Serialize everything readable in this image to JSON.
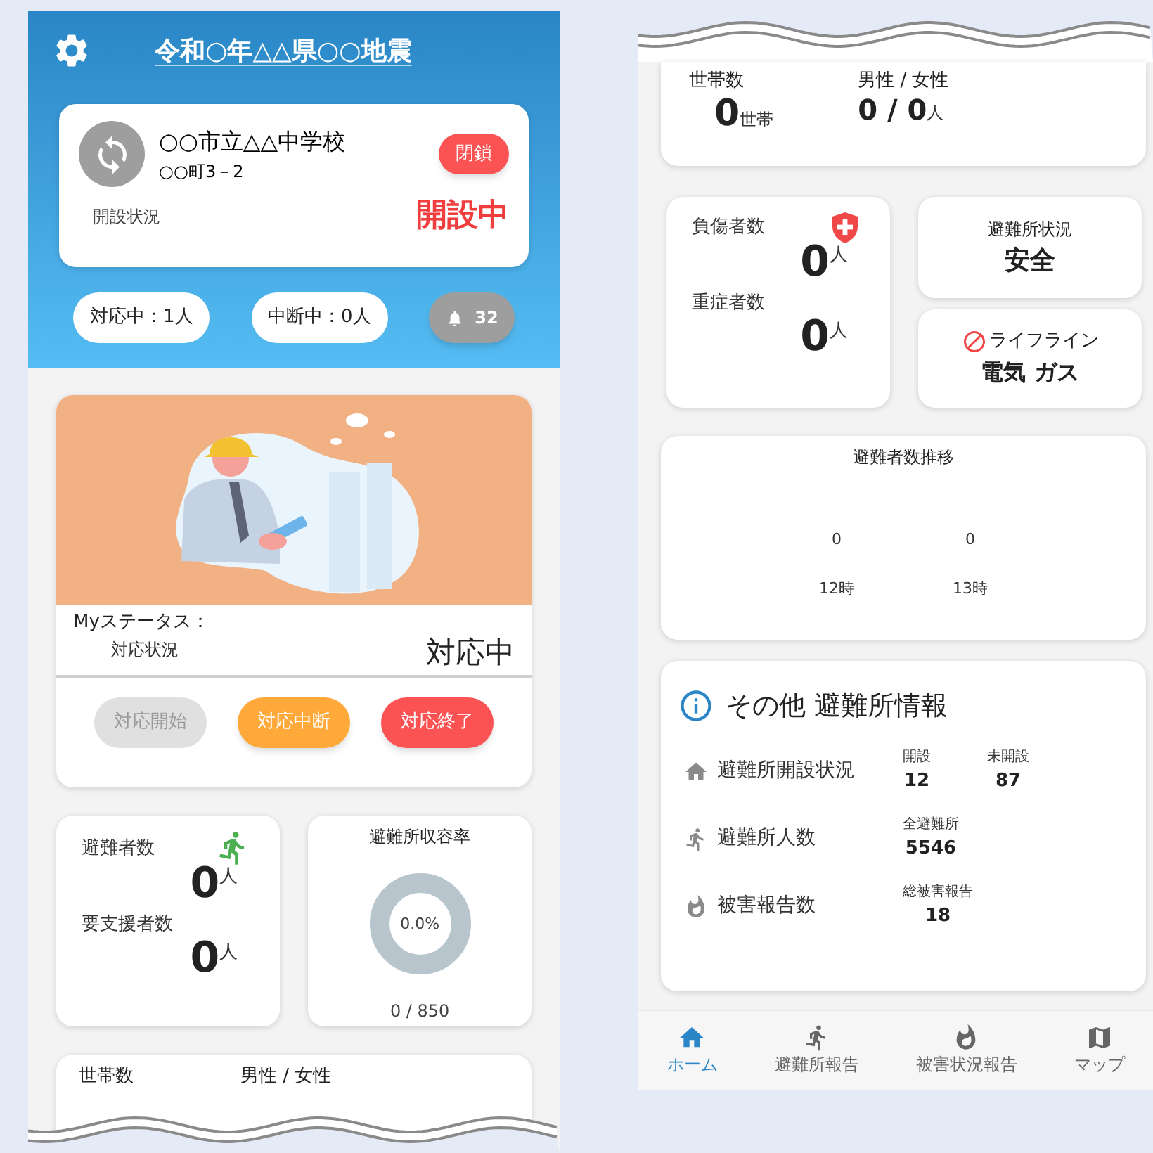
{
  "header": {
    "title": "令和○年△△県○○地震"
  },
  "shelter": {
    "name": "○○市立△△中学校",
    "address": "○○町3－2",
    "close_button": "閉鎖",
    "status_label": "開設状況",
    "status": "開設中"
  },
  "counters": [
    {
      "label": "対応中：1人"
    },
    {
      "label": "中断中：0人"
    }
  ],
  "notifications": {
    "count": "32"
  },
  "my_status": {
    "title": "Myステータス：",
    "label": "対応状況",
    "value": "対応中",
    "buttons": [
      {
        "label": "対応開始",
        "disabled": true,
        "color": "#e0e0e0"
      },
      {
        "label": "対応中断",
        "disabled": false,
        "color": "#ffa93a"
      },
      {
        "label": "対応終了",
        "disabled": false,
        "color": "#fb5253"
      }
    ]
  },
  "evacuees": {
    "label": "避難者数",
    "value": "0",
    "unit": "人"
  },
  "support_needed": {
    "label": "要支援者数",
    "value": "0",
    "unit": "人"
  },
  "capacity": {
    "title": "避難所収容率",
    "level": 0,
    "reading": "0.0%",
    "count": "0 / 850"
  },
  "households_top": {
    "households_label": "世帯数",
    "gender_label": "男性 / 女性"
  },
  "households": {
    "households_label": "世帯数",
    "households_value": "0",
    "households_unit": "世帯",
    "gender_label": "男性 / 女性",
    "gender_value": "0 / 0",
    "gender_unit": "人"
  },
  "injured": {
    "label": "負傷者数",
    "value": "0",
    "unit": "人"
  },
  "severe": {
    "label": "重症者数",
    "value": "0",
    "unit": "人"
  },
  "shelter_condition": {
    "label": "避難所状況",
    "value": "安全"
  },
  "lifeline": {
    "label": "ライフライン",
    "value": "電気 ガス"
  },
  "trend": {
    "title": "避難者数推移",
    "points": [
      {
        "value": "0",
        "time": "12時"
      },
      {
        "value": "0",
        "time": "13時"
      }
    ]
  },
  "other_info": {
    "title": "その他 避難所情報",
    "rows": [
      {
        "kind": "home",
        "label": "避難所開設状況",
        "stats": [
          {
            "label": "開設",
            "value": "12"
          },
          {
            "label": "未開設",
            "value": "87"
          }
        ]
      },
      {
        "kind": "people",
        "label": "避難所人数",
        "stats": [
          {
            "label": "全避難所",
            "value": "5546"
          }
        ]
      },
      {
        "kind": "damage",
        "label": "被害報告数",
        "stats": [
          {
            "label": "総被害報告",
            "value": "18"
          }
        ]
      }
    ]
  },
  "nav": [
    {
      "kind": "home",
      "label": "ホーム",
      "selected": true
    },
    {
      "kind": "people",
      "label": "避難所報告",
      "selected": false
    },
    {
      "kind": "damage",
      "label": "被害状況報告",
      "selected": false
    },
    {
      "kind": "map",
      "label": "マップ",
      "selected": false
    }
  ]
}
